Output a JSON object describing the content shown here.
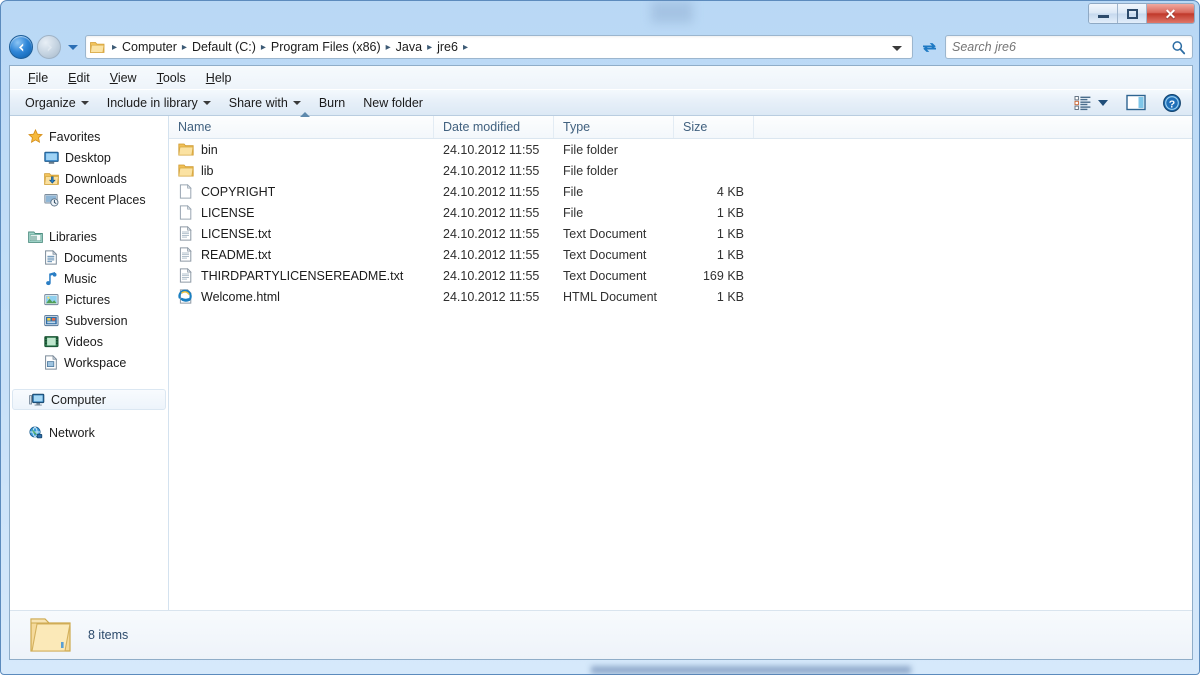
{
  "window": {
    "controls": {
      "minimize": "minimize-button",
      "maximize": "restore-button",
      "close_label": "✕"
    }
  },
  "address_bar": {
    "back_icon": "back-arrow-icon",
    "forward_icon": "forward-arrow-icon",
    "history_icon": "history-dropdown-icon",
    "folder_icon": "folder-icon",
    "breadcrumbs": [
      "Computer",
      "Default (C:)",
      "Program Files (x86)",
      "Java",
      "jre6"
    ],
    "separator": "▸",
    "refresh_icon": "refresh-icon"
  },
  "search": {
    "placeholder": "Search jre6",
    "value": "",
    "icon": "search-icon"
  },
  "menu": {
    "items": [
      {
        "prefix": "",
        "key": "F",
        "suffix": "ile"
      },
      {
        "prefix": "",
        "key": "E",
        "suffix": "dit"
      },
      {
        "prefix": "",
        "key": "V",
        "suffix": "iew"
      },
      {
        "prefix": "",
        "key": "T",
        "suffix": "ools"
      },
      {
        "prefix": "",
        "key": "H",
        "suffix": "elp"
      }
    ]
  },
  "toolbar": {
    "organize": "Organize",
    "include_in_library": "Include in library",
    "share_with": "Share with",
    "burn": "Burn",
    "new_folder": "New folder",
    "view_icon": "list-view-icon",
    "preview_pane_icon": "preview-pane-icon",
    "help_icon": "help-icon"
  },
  "sidebar": {
    "groups": [
      {
        "header": {
          "label": "Favorites",
          "icon": "star-icon"
        },
        "items": [
          {
            "label": "Desktop",
            "icon": "desktop-icon"
          },
          {
            "label": "Downloads",
            "icon": "downloads-icon"
          },
          {
            "label": "Recent Places",
            "icon": "recent-places-icon"
          }
        ]
      },
      {
        "header": {
          "label": "Libraries",
          "icon": "libraries-icon"
        },
        "items": [
          {
            "label": "Documents",
            "icon": "documents-icon"
          },
          {
            "label": "Music",
            "icon": "music-icon"
          },
          {
            "label": "Pictures",
            "icon": "pictures-icon"
          },
          {
            "label": "Subversion",
            "icon": "subversion-icon"
          },
          {
            "label": "Videos",
            "icon": "videos-icon"
          },
          {
            "label": "Workspace",
            "icon": "workspace-icon"
          }
        ]
      }
    ],
    "computer": {
      "label": "Computer",
      "icon": "computer-icon",
      "selected": true
    },
    "network": {
      "label": "Network",
      "icon": "network-icon"
    }
  },
  "file_list": {
    "columns": [
      "Name",
      "Date modified",
      "Type",
      "Size"
    ],
    "sort_column": "Name",
    "sort_direction": "ascending",
    "rows": [
      {
        "name": "bin",
        "date": "24.10.2012 11:55",
        "type": "File folder",
        "size": "",
        "icon": "folder-icon"
      },
      {
        "name": "lib",
        "date": "24.10.2012 11:55",
        "type": "File folder",
        "size": "",
        "icon": "folder-icon"
      },
      {
        "name": "COPYRIGHT",
        "date": "24.10.2012 11:55",
        "type": "File",
        "size": "4 KB",
        "icon": "blank-file-icon"
      },
      {
        "name": "LICENSE",
        "date": "24.10.2012 11:55",
        "type": "File",
        "size": "1 KB",
        "icon": "blank-file-icon"
      },
      {
        "name": "LICENSE.txt",
        "date": "24.10.2012 11:55",
        "type": "Text Document",
        "size": "1 KB",
        "icon": "text-file-icon"
      },
      {
        "name": "README.txt",
        "date": "24.10.2012 11:55",
        "type": "Text Document",
        "size": "1 KB",
        "icon": "text-file-icon"
      },
      {
        "name": "THIRDPARTYLICENSEREADME.txt",
        "date": "24.10.2012 11:55",
        "type": "Text Document",
        "size": "169 KB",
        "icon": "text-file-icon"
      },
      {
        "name": "Welcome.html",
        "date": "24.10.2012 11:55",
        "type": "HTML Document",
        "size": "1 KB",
        "icon": "html-file-icon"
      }
    ]
  },
  "status_bar": {
    "item_count": "8 items",
    "icon": "large-folder-icon"
  },
  "colors": {
    "frame": "#b9d8f5",
    "accent": "#2f86d8",
    "close_red": "#c0392b",
    "folder_yellow": "#f7d486",
    "header_text": "#41617f"
  }
}
